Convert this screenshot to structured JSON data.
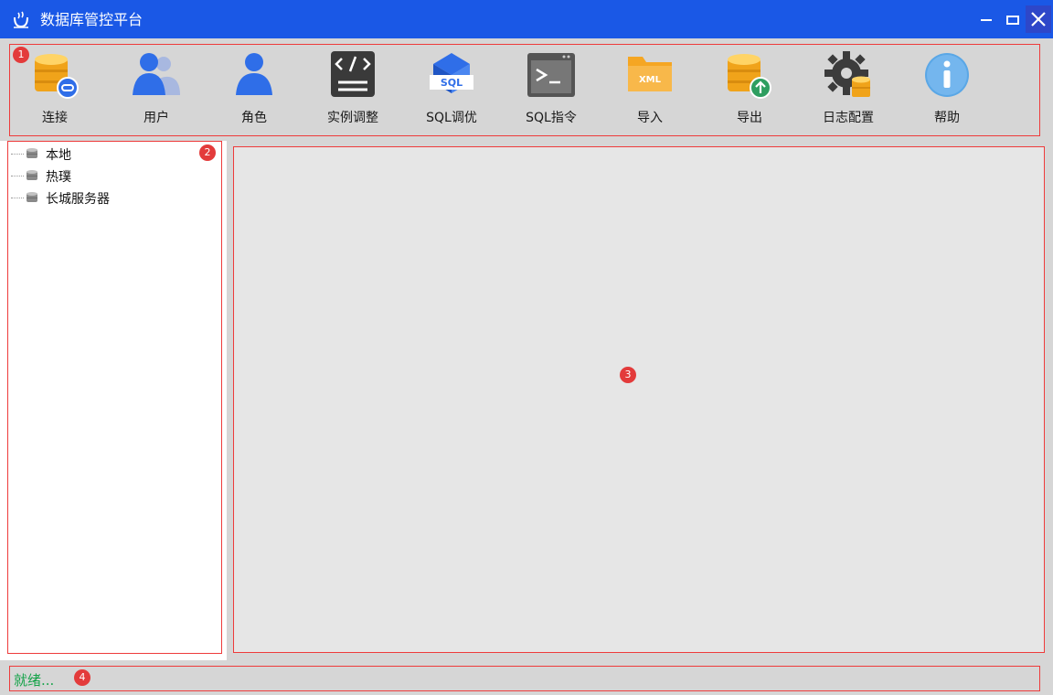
{
  "window": {
    "title": "数据库管控平台",
    "controls": [
      "minimize",
      "maximize",
      "close"
    ]
  },
  "toolbar": {
    "items": [
      {
        "label": "连接",
        "icon": "connect-database-icon"
      },
      {
        "label": "用户",
        "icon": "users-icon"
      },
      {
        "label": "角色",
        "icon": "role-icon"
      },
      {
        "label": "实例调整",
        "icon": "code-instance-icon"
      },
      {
        "label": "SQL调优",
        "icon": "sql-tuning-icon"
      },
      {
        "label": "SQL指令",
        "icon": "terminal-icon"
      },
      {
        "label": "导入",
        "icon": "xml-folder-icon"
      },
      {
        "label": "导出",
        "icon": "export-database-icon"
      },
      {
        "label": "日志配置",
        "icon": "gear-database-icon"
      },
      {
        "label": "帮助",
        "icon": "info-icon"
      }
    ]
  },
  "tree": {
    "items": [
      {
        "label": "本地",
        "icon": "database-icon"
      },
      {
        "label": "热璞",
        "icon": "database-icon"
      },
      {
        "label": "长城服务器",
        "icon": "database-icon"
      }
    ]
  },
  "annotations": {
    "badges": [
      "1",
      "2",
      "3",
      "4"
    ]
  },
  "status": {
    "text": "就绪..."
  },
  "colors": {
    "titlebar": "#1a58e6",
    "highlight_frame": "#ee3b3b",
    "status_text": "#16a34a"
  }
}
